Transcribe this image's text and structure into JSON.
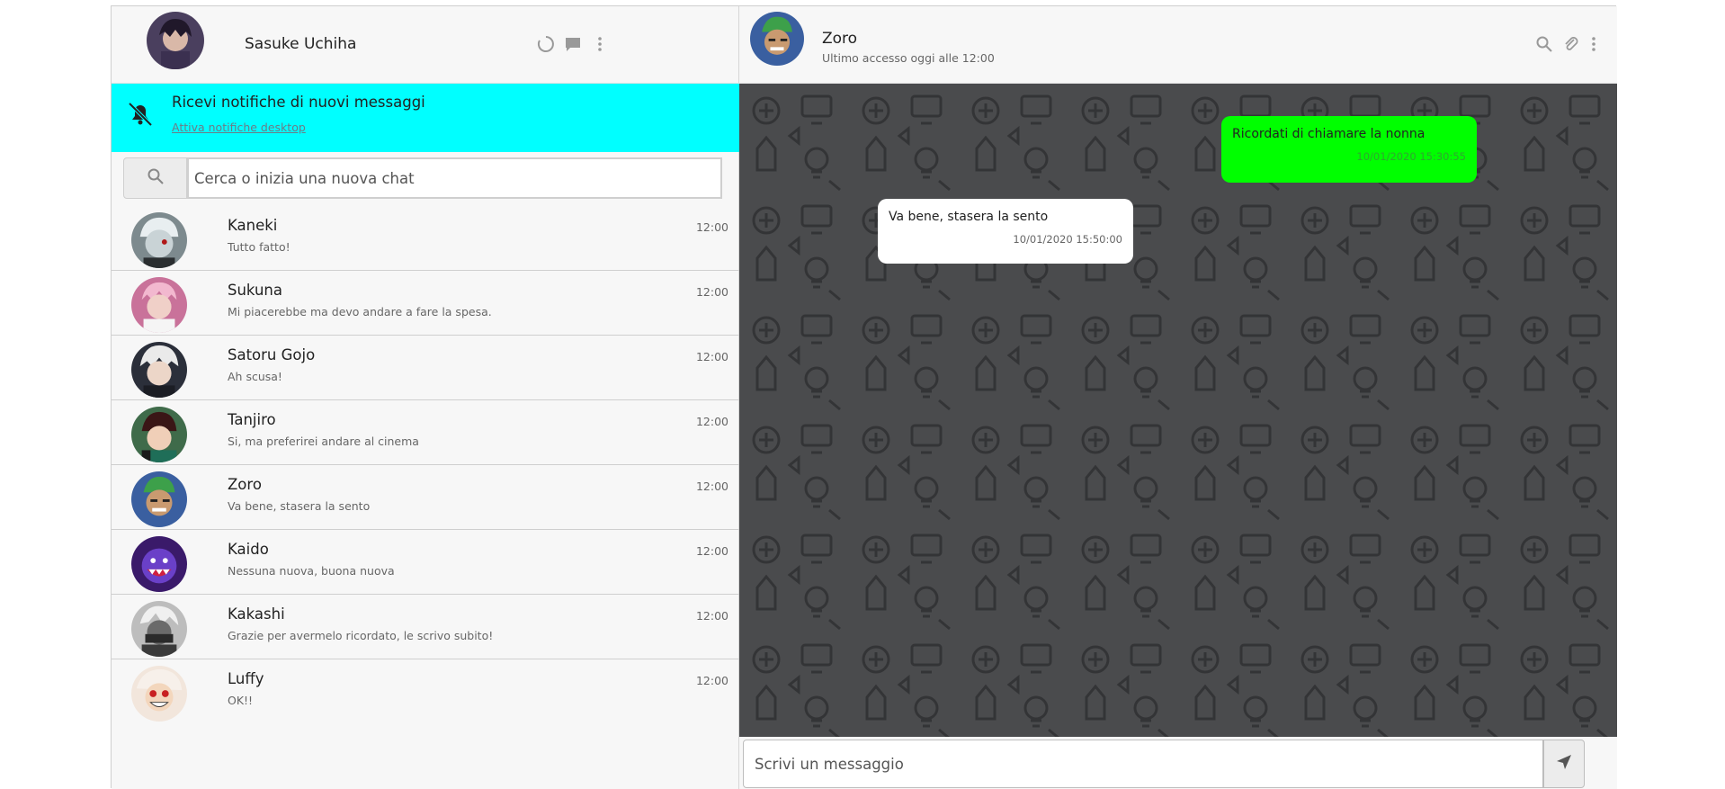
{
  "user": {
    "name": "Sasuke Uchiha"
  },
  "notification": {
    "title": "Ricevi notifiche di nuovi messaggi",
    "link": "Attiva notifiche desktop"
  },
  "search": {
    "placeholder": "Cerca o inizia una nuova chat"
  },
  "chats": [
    {
      "name": "Kaneki",
      "last_message": "Tutto fatto!",
      "time": "12:00"
    },
    {
      "name": "Sukuna",
      "last_message": "Mi piacerebbe ma devo andare a fare la spesa.",
      "time": "12:00"
    },
    {
      "name": "Satoru Gojo",
      "last_message": "Ah scusa!",
      "time": "12:00"
    },
    {
      "name": "Tanjiro",
      "last_message": "Si, ma preferirei andare al cinema",
      "time": "12:00"
    },
    {
      "name": "Zoro",
      "last_message": "Va bene, stasera la sento",
      "time": "12:00"
    },
    {
      "name": "Kaido",
      "last_message": "Nessuna nuova, buona nuova",
      "time": "12:00"
    },
    {
      "name": "Kakashi",
      "last_message": "Grazie per avermelo ricordato, le scrivo subito!",
      "time": "12:00"
    },
    {
      "name": "Luffy",
      "last_message": "OK!!",
      "time": "12:00"
    }
  ],
  "active_chat": {
    "name": "Zoro",
    "status": "Ultimo accesso oggi alle 12:00",
    "messages": [
      {
        "direction": "sent",
        "text": "Ricordati di chiamare la nonna",
        "timestamp": "10/01/2020 15:30:55"
      },
      {
        "direction": "received",
        "text": "Va bene, stasera la sento",
        "timestamp": "10/01/2020 15:50:00"
      }
    ]
  },
  "composer": {
    "placeholder": "Scrivi un messaggio"
  },
  "colors": {
    "notification_bg": "#00ffff",
    "sent_bubble": "#00ff00",
    "received_bubble": "#ffffff",
    "chat_bg": "#4a4b4d"
  },
  "icons": {
    "left_header": [
      "status-icon",
      "new-chat-icon",
      "menu-icon"
    ],
    "right_header": [
      "search-icon",
      "attach-icon",
      "menu-icon"
    ],
    "notification": "bell-off-icon",
    "search": "search-icon",
    "send": "send-icon"
  }
}
